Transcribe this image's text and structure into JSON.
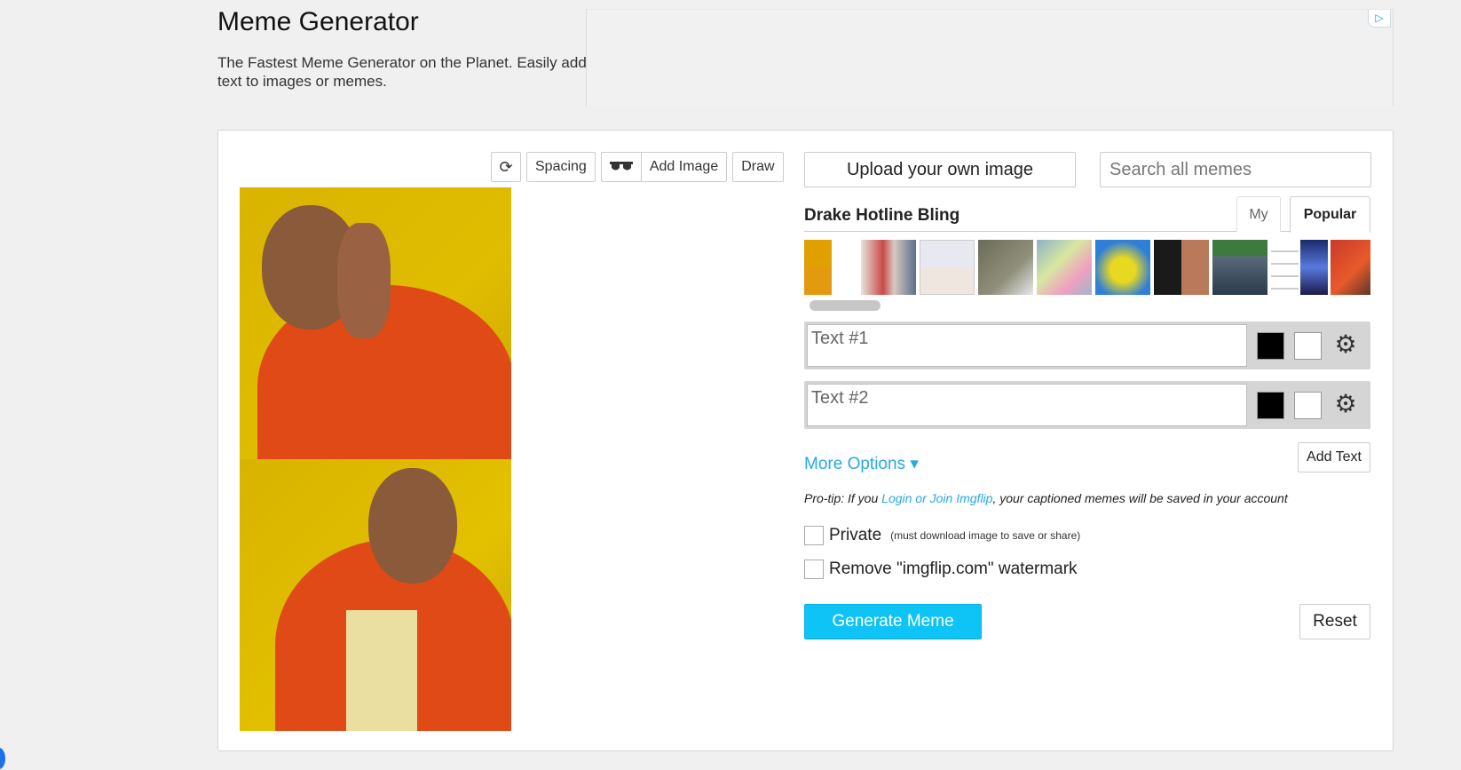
{
  "header": {
    "title": "Meme Generator",
    "description": "The Fastest Meme Generator on the Planet. Easily add text to images or memes."
  },
  "ad": {
    "icon": "adchoices-icon",
    "glyph": "▷"
  },
  "toolbar": {
    "rotate_glyph": "⟳",
    "spacing_label": "Spacing",
    "sunglasses_glyph": "▬▬",
    "add_image_label": "Add Image",
    "draw_label": "Draw"
  },
  "picker": {
    "upload_label": "Upload your own image",
    "search_placeholder": "Search all memes",
    "meme_name": "Drake Hotline Bling",
    "tabs": {
      "my": "My",
      "popular": "Popular"
    }
  },
  "text_boxes": [
    {
      "placeholder": "Text #1",
      "value": "",
      "outline_color": "#000000",
      "fill_color": "#ffffff"
    },
    {
      "placeholder": "Text #2",
      "value": "",
      "outline_color": "#000000",
      "fill_color": "#ffffff"
    }
  ],
  "options": {
    "more_options_label": "More Options",
    "more_options_glyph": "▾",
    "add_text_label": "Add Text",
    "protip_prefix": "Pro-tip: If you ",
    "protip_link": "Login or Join Imgflip",
    "protip_suffix": ", your captioned memes will be saved in your account",
    "private_label": "Private",
    "private_note": "(must download image to save or share)",
    "watermark_label": "Remove \"imgflip.com\" watermark"
  },
  "actions": {
    "generate_label": "Generate Meme",
    "reset_label": "Reset"
  },
  "colors": {
    "accent": "#0ec3f6",
    "link": "#29a9e0"
  }
}
